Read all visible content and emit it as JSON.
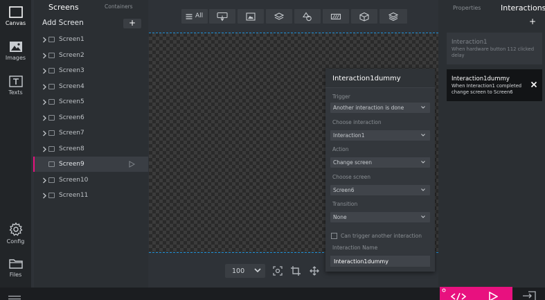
{
  "rail": {
    "canvas": "Canvas",
    "images": "Images",
    "texts": "Texts",
    "config": "Config",
    "files": "Files"
  },
  "screens_panel": {
    "tab_screens": "Screens",
    "tab_containers": "Containers",
    "add_screen": "Add Screen",
    "add_icon": "+",
    "items": [
      {
        "label": "Screen1"
      },
      {
        "label": "Screen2"
      },
      {
        "label": "Screen3"
      },
      {
        "label": "Screen4"
      },
      {
        "label": "Screen5"
      },
      {
        "label": "Screen6"
      },
      {
        "label": "Screen7"
      },
      {
        "label": "Screen8"
      },
      {
        "label": "Screen9"
      },
      {
        "label": "Screen10"
      },
      {
        "label": "Screen11"
      }
    ],
    "selected": "Screen9"
  },
  "toolbar": {
    "all_label": "All"
  },
  "zoom": {
    "value": "100"
  },
  "popup": {
    "title": "Interaction1dummy",
    "trigger_label": "Trigger",
    "trigger_value": "Another interaction is done",
    "choose_interaction_label": "Choose interaction",
    "choose_interaction_value": "Interaction1",
    "action_label": "Action",
    "action_value": "Change screen",
    "choose_screen_label": "Choose screen",
    "choose_screen_value": "Screen6",
    "transition_label": "Transition",
    "transition_value": "None",
    "can_trigger_label": "Can trigger another interaction",
    "name_label": "Interaction Name",
    "name_value": "Interaction1dummy"
  },
  "right_panel": {
    "tab_properties": "Properties",
    "tab_interactions": "Interactions",
    "add_icon": "+",
    "interactions": [
      {
        "title": "Interaction1",
        "desc": "When hardware button 112 clicked delay"
      },
      {
        "title": "Interaction1dummy",
        "desc": "When Interaction1 completed change screen to Screen6"
      }
    ]
  },
  "colors": {
    "accent": "#e8117f",
    "canvas_border": "#1e90d6"
  }
}
